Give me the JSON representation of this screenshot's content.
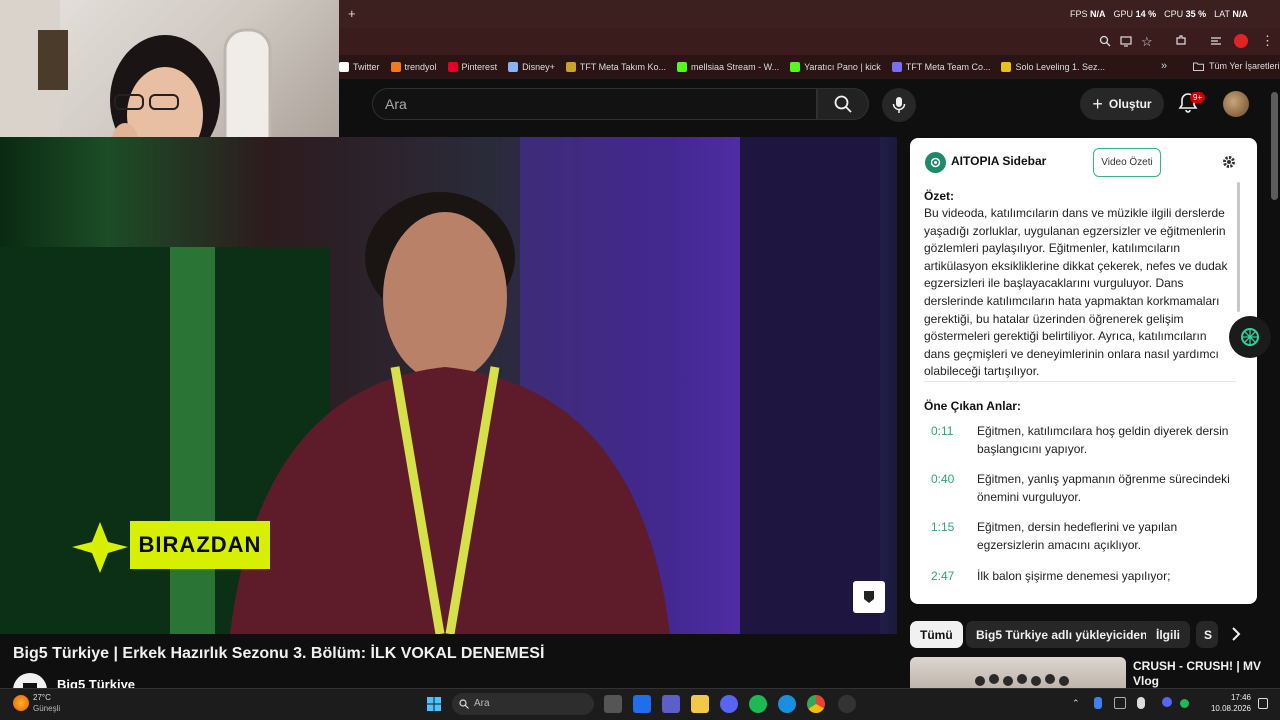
{
  "browser": {
    "new_tab": "+",
    "stats": {
      "fps_label": "FPS",
      "fps_value": "N/A",
      "gpu_label": "GPU",
      "gpu_value": "14 %",
      "cpu_label": "CPU",
      "cpu_value": "35 %",
      "lat_label": "LAT",
      "lat_value": "N/A"
    },
    "bookmarks": [
      {
        "label": "Twitter",
        "icon": "x-icon",
        "color": "#ffffff"
      },
      {
        "label": "trendyol",
        "icon": "trendyol-icon",
        "color": "#f27a1a"
      },
      {
        "label": "Pinterest",
        "icon": "pinterest-icon",
        "color": "#e60023"
      },
      {
        "label": "Disney+",
        "icon": "globe-icon",
        "color": "#8ab4f8"
      },
      {
        "label": "TFT Meta Takım Ko...",
        "icon": "tft-icon",
        "color": "#c9a227"
      },
      {
        "label": "mellsiaa Stream - W...",
        "icon": "kick-icon",
        "color": "#53fc18"
      },
      {
        "label": "Yaratıcı Pano | kick",
        "icon": "kick-icon",
        "color": "#53fc18"
      },
      {
        "label": "TFT Meta Team Co...",
        "icon": "tft-icon",
        "color": "#7b6ef6"
      },
      {
        "label": "Solo Leveling 1. Sez...",
        "icon": "bookmark-icon",
        "color": "#e8c21b"
      }
    ],
    "all_bookmarks": "Tüm Yer İşaretleri"
  },
  "youtube": {
    "search_placeholder": "Ara",
    "create_label": "Oluştur",
    "notification_count": "9+",
    "video_badge": "BIRAZDAN",
    "video_title": "Big5 Türkiye | Erkek Hazırlık Sezonu 3. Bölüm: İLK VOKAL DENEMESİ",
    "channel_name": "Big5 Türkiye",
    "chips": [
      "Tümü",
      "Big5 Türkiye adlı yükleyiciden",
      "İlgili",
      "S"
    ],
    "next_video_title": "CRUSH - CRUSH! | MV Vlog"
  },
  "aitopia": {
    "title": "AITOPIA Sidebar",
    "video_summary_button": "Video Özeti",
    "summary_heading": "Özet:",
    "summary_text": "Bu videoda, katılımcıların dans ve müzikle ilgili derslerde yaşadığı zorluklar, uygulanan egzersizler ve eğitmenlerin gözlemleri paylaşılıyor. Eğitmenler, katılımcıların artikülasyon eksikliklerine dikkat çekerek, nefes ve dudak egzersizleri ile başlayacaklarını vurguluyor. Dans derslerinde katılımcıların hata yapmaktan korkmamaları gerektiği, bu hatalar üzerinden öğrenerek gelişim göstermeleri gerektiği belirtiliyor. Ayrıca, katılımcıların dans geçmişleri ve deneyimlerinin onlara nasıl yardımcı olabileceği tartışılıyor.",
    "highlights_heading": "Öne Çıkan Anlar:",
    "highlights": [
      {
        "time": "0:11",
        "text": "Eğitmen, katılımcılara hoş geldin diyerek dersin başlangıcını yapıyor."
      },
      {
        "time": "0:40",
        "text": "Eğitmen, yanlış yapmanın öğrenme sürecindeki önemini vurguluyor."
      },
      {
        "time": "1:15",
        "text": "Eğitmen, dersin hedeflerini ve yapılan egzersizlerin amacını açıklıyor."
      },
      {
        "time": "2:47",
        "text": "İlk balon şişirme denemesi yapılıyor;"
      }
    ]
  },
  "taskbar": {
    "weather_temp": "27°C",
    "weather_desc": "Güneşli",
    "search_placeholder": "Ara",
    "time": "17:46",
    "date": "10.08.2026"
  },
  "colors": {
    "accent_green": "#2fa37e",
    "youtube_red": "#cc0000",
    "badge_yellow": "#d6f000"
  }
}
